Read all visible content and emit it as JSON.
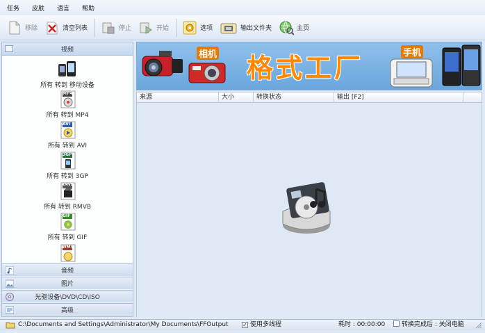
{
  "menu": [
    "任务",
    "皮肤",
    "语言",
    "帮助"
  ],
  "toolbar": {
    "remove": "移除",
    "clear_list": "清空列表",
    "stop": "停止",
    "start": "开始",
    "options": "选项",
    "output_folder": "输出文件夹",
    "home": "主页"
  },
  "sidebar": {
    "video_header": "视频",
    "items": [
      {
        "label": "所有 转到 移动设备",
        "badge": ""
      },
      {
        "label": "所有 转到 MP4",
        "badge": "MP4"
      },
      {
        "label": "所有 转到 AVI",
        "badge": "AVI"
      },
      {
        "label": "所有 转到 3GP",
        "badge": "3GP"
      },
      {
        "label": "所有 转到 RMVB",
        "badge": "RMVB"
      },
      {
        "label": "所有 转到 GIF",
        "badge": "GIF"
      },
      {
        "label": "",
        "badge": "WMV"
      }
    ],
    "categories": [
      "音频",
      "图片",
      "光驱设备\\DVD\\CD\\ISO",
      "高级"
    ]
  },
  "banner": {
    "title": "格式工厂",
    "camera_label": "相机",
    "phone_label": "手机"
  },
  "table": {
    "columns": [
      "来源",
      "大小",
      "转换状态",
      "输出 [F2]"
    ]
  },
  "statusbar": {
    "path": "C:\\Documents and Settings\\Administrator\\My Documents\\FFOutput",
    "multithread": "使用多线程",
    "elapsed": "耗时 : 00:00:00",
    "after_convert": "转换完成后 : 关闭电脑"
  },
  "colors": {
    "banner_title": "#ff8a00",
    "panel_bg": "#dfe9f5"
  }
}
